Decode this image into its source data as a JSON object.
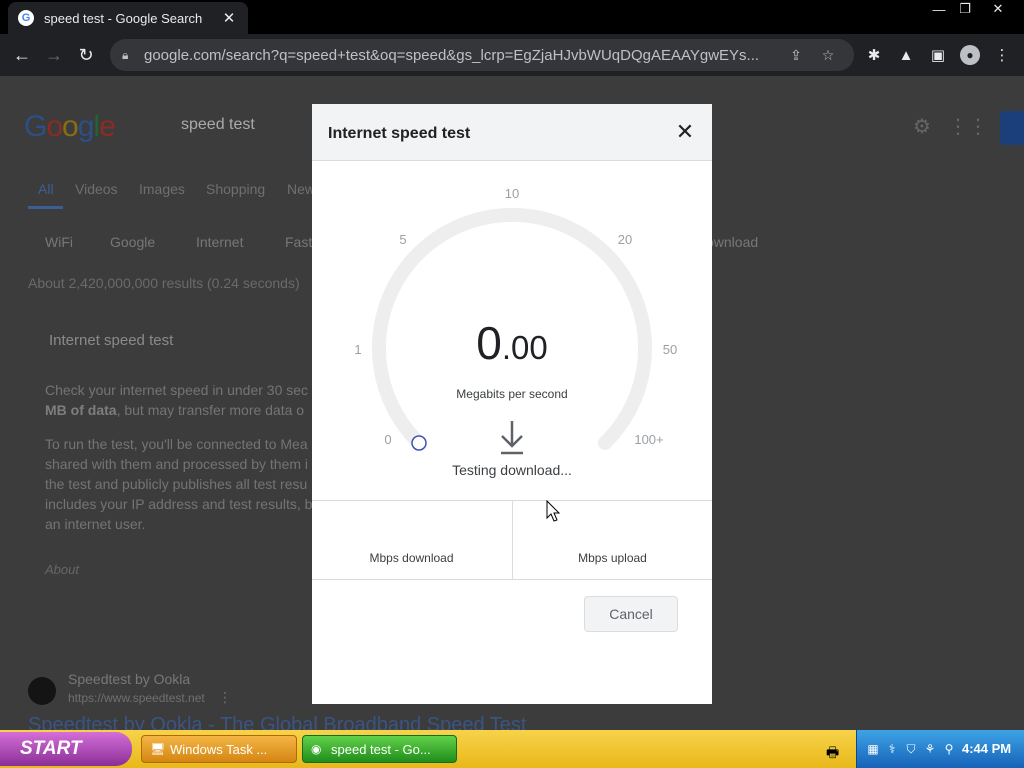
{
  "browser": {
    "tab_title": "speed test - Google Search",
    "favicon_letter": "G",
    "tab_close": "✕",
    "url": "google.com/search?q=speed+test&oq=speed&gs_lcrp=EgZjaHJvbWUqDQgAEAAYgwEYs...",
    "window_controls": [
      "—",
      "❐",
      "✕"
    ]
  },
  "page": {
    "logo_letters": [
      {
        "ch": "G",
        "color": "#2d4e86"
      },
      {
        "ch": "o",
        "color": "#8c2b22"
      },
      {
        "ch": "o",
        "color": "#8a6d12"
      },
      {
        "ch": "g",
        "color": "#2d4e86"
      },
      {
        "ch": "l",
        "color": "#226234"
      },
      {
        "ch": "e",
        "color": "#8c2b22"
      }
    ],
    "search_query": "speed test",
    "tabs": [
      "All",
      "Videos",
      "Images",
      "Shopping",
      "New"
    ],
    "chips": [
      "WiFi",
      "Google",
      "Internet",
      "Fast",
      "ownload"
    ],
    "result_stats": "About 2,420,000,000 results (0.24 seconds)",
    "widget_title": "Internet speed test",
    "body_lines": [
      "Check your internet speed in under 30 sec",
      "MB of data, but may transfer more data o",
      "To run the test, you'll be connected to Mea",
      "shared with them and processed by them i",
      "the test and publicly publishes all test resu",
      "includes your IP address and test results, b",
      "an internet user."
    ],
    "body_line2_bold": "MB of data",
    "body_line2_rest": ", but may transfer more data o",
    "about": "About",
    "result_site": "Speedtest by Ookla",
    "result_url": "https://www.speedtest.net",
    "result_more": "⋮",
    "result_title": "Speedtest by Ookla - The Global Broadband Speed Test"
  },
  "modal": {
    "title": "Internet speed test",
    "close": "✕",
    "gauge": {
      "scale_labels": [
        "0",
        "1",
        "5",
        "10",
        "20",
        "50",
        "100+"
      ],
      "value_int": "0",
      "value_dec": ".00",
      "unit": "Megabits per second",
      "progress": 0
    },
    "status": "Testing download...",
    "download_label": "Mbps download",
    "upload_label": "Mbps upload",
    "cancel_label": "Cancel"
  },
  "taskbar": {
    "start_label": "START",
    "tasks": [
      "Windows Task ...",
      "speed test - Go..."
    ],
    "clock": "4:44 PM"
  }
}
